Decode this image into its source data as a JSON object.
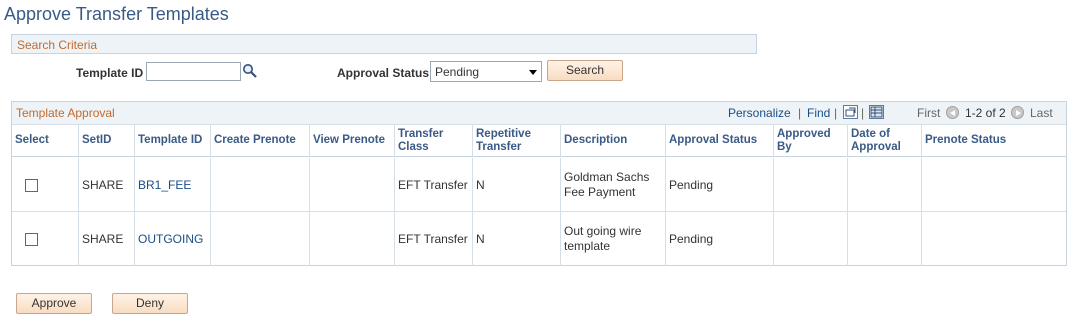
{
  "page_title": "Approve Transfer Templates",
  "search": {
    "section_title": "Search Criteria",
    "template_id_label": "Template ID",
    "template_id_value": "",
    "approval_status_label": "Approval Status",
    "approval_status_value": "Pending",
    "search_button": "Search"
  },
  "grid": {
    "section_title": "Template Approval",
    "personalize": "Personalize",
    "find": "Find",
    "separator": "|",
    "first": "First",
    "range": "1-2 of 2",
    "last": "Last",
    "columns": [
      "Select",
      "SetID",
      "Template ID",
      "Create Prenote",
      "View Prenote",
      "Transfer Class",
      "Repetitive Transfer",
      "Description",
      "Approval Status",
      "Approved By",
      "Date of Approval",
      "Prenote Status"
    ],
    "rows": [
      {
        "setid": "SHARE",
        "template_id": "BR1_FEE",
        "transfer_class": "EFT Transfer",
        "repetitive": "N",
        "description": "Goldman Sachs Fee Payment",
        "approval_status": "Pending"
      },
      {
        "setid": "SHARE",
        "template_id": "OUTGOING",
        "transfer_class": "EFT Transfer",
        "repetitive": "N",
        "description": "Out going wire template",
        "approval_status": "Pending"
      }
    ]
  },
  "actions": {
    "approve": "Approve",
    "deny": "Deny"
  }
}
